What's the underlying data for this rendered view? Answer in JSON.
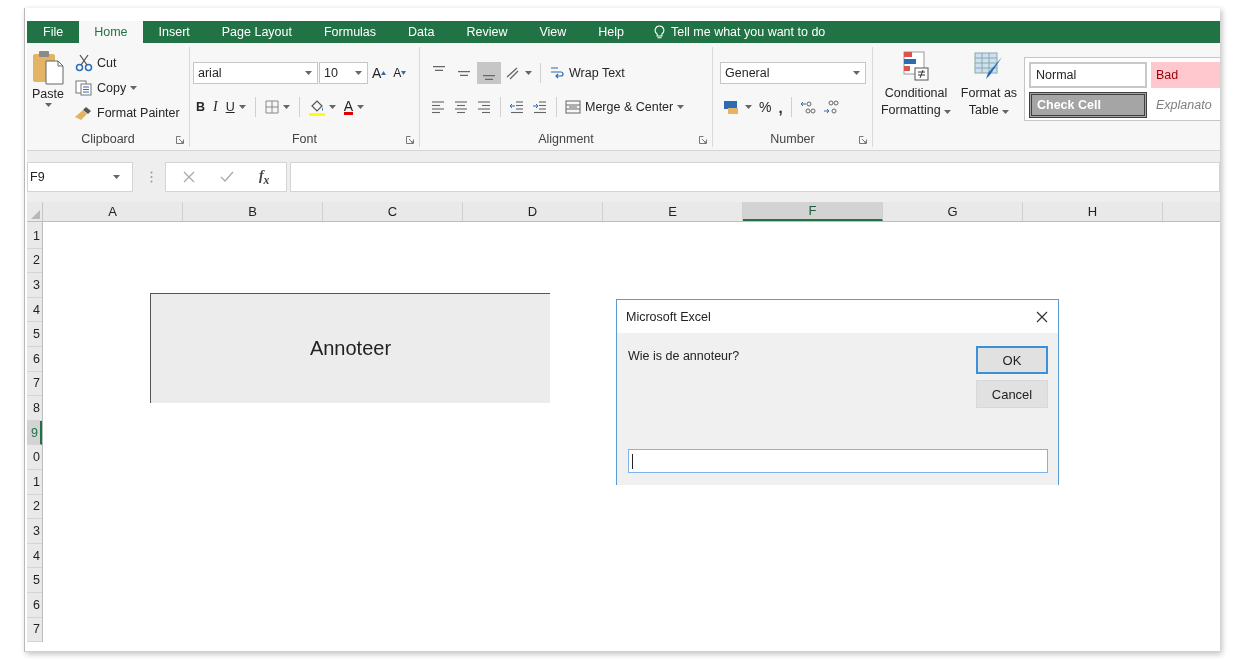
{
  "tabs": [
    {
      "label": "File",
      "selected": false
    },
    {
      "label": "Home",
      "selected": true
    },
    {
      "label": "Insert",
      "selected": false
    },
    {
      "label": "Page Layout",
      "selected": false
    },
    {
      "label": "Formulas",
      "selected": false
    },
    {
      "label": "Data",
      "selected": false
    },
    {
      "label": "Review",
      "selected": false
    },
    {
      "label": "View",
      "selected": false
    },
    {
      "label": "Help",
      "selected": false
    }
  ],
  "tell_me": "Tell me what you want to do",
  "ribbon": {
    "clipboard": {
      "label": "Clipboard",
      "paste": "Paste",
      "cut": "Cut",
      "copy": "Copy",
      "format_painter": "Format Painter"
    },
    "font": {
      "label": "Font",
      "font_name": "arial",
      "font_size": "10",
      "grow": "A",
      "shrink": "A",
      "bold": "B",
      "italic": "I",
      "underline": "U",
      "font_color": "A"
    },
    "alignment": {
      "label": "Alignment",
      "wrap_text": "Wrap Text",
      "merge_center": "Merge & Center",
      "vertical_align": [
        {
          "kind": "top",
          "selected": false
        },
        {
          "kind": "middle",
          "selected": false
        },
        {
          "kind": "bottom",
          "selected": true
        }
      ]
    },
    "number": {
      "label": "Number",
      "format": "General",
      "percent": "%",
      "comma": ","
    },
    "styles": {
      "conditional_formatting": "Conditional Formatting",
      "format_as_table": "Format as Table",
      "cells": [
        {
          "label": "Normal",
          "kind": "normal"
        },
        {
          "label": "Bad",
          "kind": "bad"
        },
        {
          "label": "Check Cell",
          "kind": "check"
        },
        {
          "label": "Explanato",
          "kind": "explanatory"
        }
      ]
    }
  },
  "formula_bar": {
    "name_box": "F9",
    "function": "f$_{x}$"
  },
  "sheet": {
    "columns": [
      {
        "label": "A",
        "selected": false
      },
      {
        "label": "B",
        "selected": false
      },
      {
        "label": "C",
        "selected": false
      },
      {
        "label": "D",
        "selected": false
      },
      {
        "label": "E",
        "selected": false
      },
      {
        "label": "F",
        "selected": true
      },
      {
        "label": "G",
        "selected": false
      },
      {
        "label": "H",
        "selected": false
      }
    ],
    "rows": [
      {
        "label": "1",
        "selected": false
      },
      {
        "label": "2",
        "selected": false
      },
      {
        "label": "3",
        "selected": false
      },
      {
        "label": "4",
        "selected": false
      },
      {
        "label": "5",
        "selected": false
      },
      {
        "label": "6",
        "selected": false
      },
      {
        "label": "7",
        "selected": false
      },
      {
        "label": "8",
        "selected": false
      },
      {
        "label": "9",
        "selected": true
      },
      {
        "label": "0",
        "selected": false
      },
      {
        "label": "1",
        "selected": false
      },
      {
        "label": "2",
        "selected": false
      },
      {
        "label": "3",
        "selected": false
      },
      {
        "label": "4",
        "selected": false
      },
      {
        "label": "5",
        "selected": false
      },
      {
        "label": "6",
        "selected": false
      },
      {
        "label": "7",
        "selected": false
      }
    ],
    "shape": "Annoteer"
  },
  "dialog": {
    "title": "Microsoft Excel",
    "prompt": "Wie is de annoteur?",
    "buttons": [
      {
        "label": "OK",
        "default": true
      },
      {
        "label": "Cancel",
        "default": false
      }
    ]
  }
}
